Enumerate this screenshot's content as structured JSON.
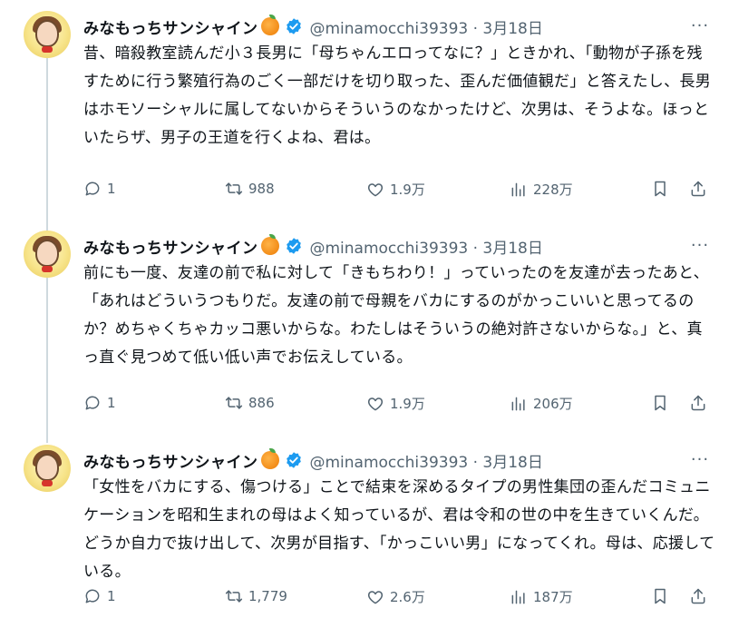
{
  "tweets": [
    {
      "name": "みなもっちサンシャイン",
      "handle": "@minamocchi39393 · 3月18日",
      "text": "昔、暗殺教室読んだ小３長男に「母ちゃんエロってなに？」ときかれ、「動物が子孫を残すために行う繁殖行為のごく一部だけを切り取った、歪んだ価値観だ」と答えたし、長男はホモソーシャルに属してないからそういうのなかったけど、次男は、そうよな。ほっといたらザ、男子の王道を行くよね、君は。",
      "replies": "1",
      "retweets": "988",
      "likes": "1.9万",
      "views": "228万"
    },
    {
      "name": "みなもっちサンシャイン",
      "handle": "@minamocchi39393 · 3月18日",
      "text": "前にも一度、友達の前で私に対して「きもちわり！」っていったのを友達が去ったあと、「あれはどういうつもりだ。友達の前で母親をバカにするのがかっこいいと思ってるのか？めちゃくちゃカッコ悪いからな。わたしはそういうの絶対許さないからな。」と、真っ直ぐ見つめて低い低い声でお伝えしている。",
      "replies": "1",
      "retweets": "886",
      "likes": "1.9万",
      "views": "206万"
    },
    {
      "name": "みなもっちサンシャイン",
      "handle": "@minamocchi39393 · 3月18日",
      "text": "「女性をバカにする、傷つける」ことで結束を深めるタイプの男性集団の歪んだコミュニケーションを昭和生まれの母はよく知っているが、君は令和の世の中を生きていくんだ。どうか自力で抜け出して、次男が目指す、「かっこいい男」になってくれ。母は、応援している。",
      "replies": "1",
      "retweets": "1,779",
      "likes": "2.6万",
      "views": "187万"
    }
  ],
  "colors": {
    "text": "#0f1419",
    "muted": "#536471",
    "verified": "#1d9bf0",
    "thread": "#cfd9de"
  },
  "icons": [
    "reply-icon",
    "retweet-icon",
    "like-icon",
    "views-icon",
    "bookmark-icon",
    "share-icon",
    "more-icon",
    "verified-icon",
    "orange-emoji-icon"
  ]
}
